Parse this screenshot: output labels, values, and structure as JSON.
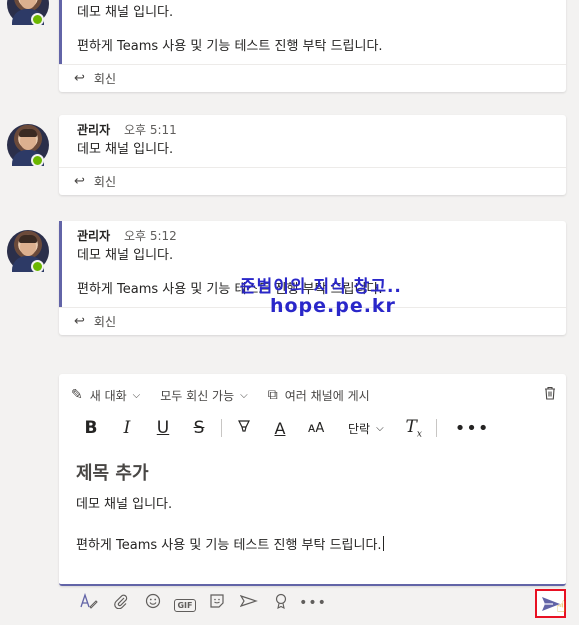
{
  "messages": [
    {
      "author": "",
      "time": "",
      "lines": [
        "데모 채널 입니다.",
        "편하게 Teams 사용 및 기능 테스트 진행 부탁 드립니다."
      ],
      "reply_label": "회신"
    },
    {
      "author": "관리자",
      "time": "오후 5:11",
      "lines": [
        "데모 채널 입니다."
      ],
      "reply_label": "회신"
    },
    {
      "author": "관리자",
      "time": "오후 5:12",
      "lines": [
        "데모 채널 입니다.",
        "편하게 Teams 사용 및 기능 테스트 진행 부탁 드립니다."
      ],
      "reply_label": "회신"
    }
  ],
  "watermark": {
    "line1": "준범이의 지식 창고..",
    "line2": "hope.pe.kr"
  },
  "composer": {
    "post_type": "새 대화",
    "reply_permission": "모두 회신 가능",
    "multi_channel": "여러 채널에 게시",
    "paragraph": "단락",
    "subject_placeholder": "제목 추가",
    "content_line1": "데모 채널 입니다.",
    "content_line2": "편하게 Teams 사용 및 기능 테스트 진행 부탁 드립니다."
  },
  "colors": {
    "accent": "#6264a7",
    "presence": "#6bb700",
    "send_highlight": "#e81123",
    "watermark": "#2a27c9"
  }
}
